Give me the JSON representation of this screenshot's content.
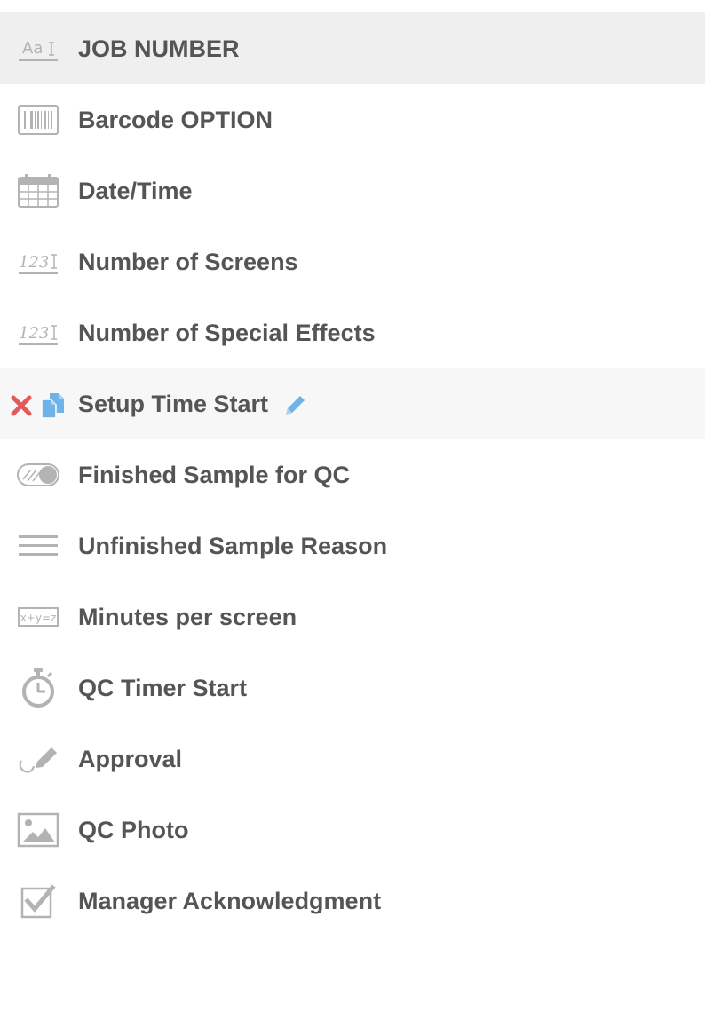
{
  "fields": [
    {
      "label": "JOB NUMBER",
      "icon": "text-field-icon",
      "icon_text": "Aa",
      "state": "selected"
    },
    {
      "label": "Barcode OPTION",
      "icon": "barcode-icon"
    },
    {
      "label": "Date/Time",
      "icon": "calendar-icon"
    },
    {
      "label": "Number of Screens",
      "icon": "number-field-icon",
      "icon_text": "123"
    },
    {
      "label": "Number of Special Effects",
      "icon": "number-field-icon",
      "icon_text": "123"
    },
    {
      "label": "Setup Time Start",
      "icon": "delete-icon",
      "state": "hovered",
      "actions": [
        "delete-icon",
        "duplicate-icon",
        "edit-pencil-icon"
      ]
    },
    {
      "label": "Finished Sample for QC",
      "icon": "toggle-icon"
    },
    {
      "label": "Unfinished Sample Reason",
      "icon": "paragraph-icon"
    },
    {
      "label": "Minutes per screen",
      "icon": "formula-icon",
      "icon_text": "x+y=z"
    },
    {
      "label": "QC Timer Start",
      "icon": "stopwatch-icon"
    },
    {
      "label": "Approval",
      "icon": "signature-icon"
    },
    {
      "label": "QC Photo",
      "icon": "image-icon"
    },
    {
      "label": "Manager Acknowledgment",
      "icon": "checkbox-icon"
    }
  ],
  "colors": {
    "label": "#555555",
    "icon": "#b3b3b3",
    "selected_bg": "#efefef",
    "hover_bg": "#f7f7f7",
    "delete": "#e25a5a",
    "action_blue": "#6fb3e8"
  }
}
